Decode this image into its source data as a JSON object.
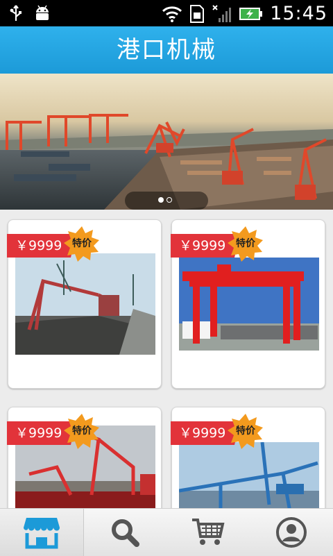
{
  "status_bar": {
    "time": "15:45"
  },
  "header": {
    "title": "港口机械"
  },
  "banner": {
    "page_count": 2,
    "active_index": 0
  },
  "products": [
    {
      "price": "￥9999",
      "badge": "特价"
    },
    {
      "price": "￥9999",
      "badge": "特价"
    },
    {
      "price": "￥9999",
      "badge": "特价"
    },
    {
      "price": "￥9999",
      "badge": "特价"
    }
  ],
  "tab_bar": {
    "tabs": [
      {
        "icon": "store-icon",
        "active": true
      },
      {
        "icon": "search-icon",
        "active": false
      },
      {
        "icon": "cart-icon",
        "active": false
      },
      {
        "icon": "profile-icon",
        "active": false
      }
    ]
  },
  "colors": {
    "header": "#1c9ad8",
    "price_tag": "#e2333a",
    "badge": "#f39a1e",
    "active_tab_icon": "#1c9ad8",
    "inactive_tab_icon": "#555555"
  }
}
